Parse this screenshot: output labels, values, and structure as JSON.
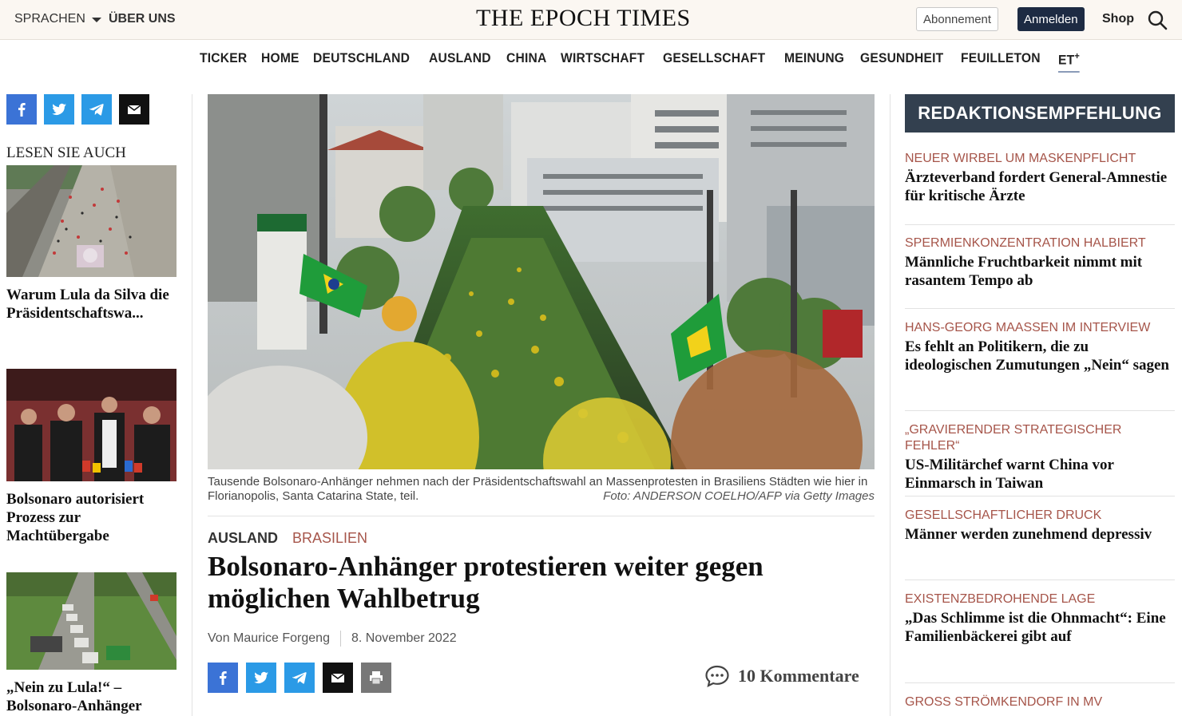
{
  "topbar": {
    "language": "SPRACHEN",
    "about": "ÜBER UNS",
    "logo": "THE EPOCH TIMES",
    "subscribe": "Abonnement",
    "login": "Anmelden",
    "shop": "Shop"
  },
  "nav": [
    "TICKER",
    "HOME",
    "DEUTSCHLAND",
    "AUSLAND",
    "CHINA",
    "WIRTSCHAFT",
    "GESELLSCHAFT",
    "MEINUNG",
    "GESUNDHEIT",
    "FEUILLETON"
  ],
  "nav_etplus": "ET",
  "nav_etplus_sup": "+",
  "left": {
    "heading": "LESEN SIE AUCH",
    "teasers": [
      {
        "title": "Warum Lula da Silva die Präsidentschaftswa..."
      },
      {
        "title": "Bolsonaro autorisiert Prozess zur Machtübergabe"
      },
      {
        "title": "„Nein zu Lula!“ – Bolsonaro-Anhänger"
      }
    ]
  },
  "article": {
    "caption": "Tausende Bolsonaro-Anhänger nehmen nach der Präsidentschaftswahl an Massenprotesten in Brasiliens Städten wie hier in Florianopolis, Santa Catarina State, teil.",
    "credit": "Foto: ANDERSON COELHO/AFP via Getty Images",
    "section": "AUSLAND",
    "topic": "BRASILIEN",
    "headline": "Bolsonaro-Anhänger protestieren weiter gegen möglichen Wahlbetrug",
    "author": "Von Maurice Forgeng",
    "date": "8. November 2022",
    "comments": "10 Kommentare"
  },
  "right": {
    "heading": "REDAKTIONSEMPFEHLUNG",
    "items": [
      {
        "kicker": "NEUER WIRBEL UM MASKENPFLICHT",
        "title": "Ärzteverband fordert General-Amnestie für kritische Ärzte"
      },
      {
        "kicker": "SPERMIENKONZENTRATION HALBIERT",
        "title": "Männliche Fruchtbarkeit nimmt mit rasantem Tempo ab"
      },
      {
        "kicker": "HANS-GEORG MAASSEN IM INTERVIEW",
        "title": "Es fehlt an Politikern, die zu ideologischen Zumutungen „Nein“ sagen"
      },
      {
        "kicker": "„GRAVIERENDER STRATEGISCHER FEHLER“",
        "title": "US-Militärchef warnt China vor Einmarsch in Taiwan"
      },
      {
        "kicker": "GESELLSCHAFTLICHER DRUCK",
        "title": "Männer werden zunehmend depressiv"
      },
      {
        "kicker": "EXISTENZBEDROHENDE LAGE",
        "title": "„Das Schlimme ist die Ohnmacht“: Eine Familienbäckerei gibt auf"
      },
      {
        "kicker": "GROSS STRÖMKENDORF IN MV",
        "title": ""
      }
    ]
  },
  "colors": {
    "accent_red": "#a6554a",
    "navy": "#1d2b43",
    "reco_header": "#33404f",
    "facebook": "#3b73d6",
    "twitter": "#2b9ae6"
  },
  "icons": [
    "facebook-icon",
    "twitter-icon",
    "telegram-icon",
    "mail-icon",
    "print-icon",
    "search-icon",
    "comment-icon",
    "caret-down-icon"
  ]
}
